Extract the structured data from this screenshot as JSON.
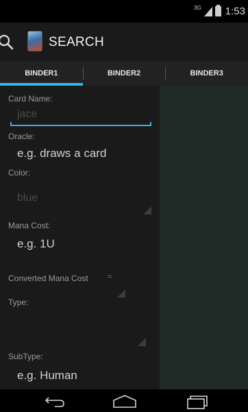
{
  "status_bar": {
    "network": "3G",
    "time": "1:53"
  },
  "action_bar": {
    "title": "SEARCH"
  },
  "tabs": [
    {
      "label": "BINDER1",
      "active": true
    },
    {
      "label": "BINDER2",
      "active": false
    },
    {
      "label": "BINDER3",
      "active": false
    }
  ],
  "form": {
    "card_name": {
      "label": "Card Name:",
      "value": "jace"
    },
    "oracle": {
      "label": "Oracle:",
      "placeholder": "e.g. draws a card"
    },
    "color": {
      "label": "Color:",
      "value": "blue"
    },
    "mana_cost": {
      "label": "Mana Cost:",
      "placeholder": "e.g. 1U"
    },
    "cmc": {
      "label": "Converted Mana Cost",
      "operator": "="
    },
    "type": {
      "label": "Type:"
    },
    "subtype": {
      "label": "SubType:",
      "placeholder": "e.g. Human"
    }
  },
  "colors": {
    "accent": "#33b5e5",
    "background": "#1a1a1a",
    "right_pane": "#1f2a27"
  },
  "nav_bar": {
    "back_icon": "back-icon",
    "home_icon": "home-icon",
    "recents_icon": "recents-icon"
  }
}
